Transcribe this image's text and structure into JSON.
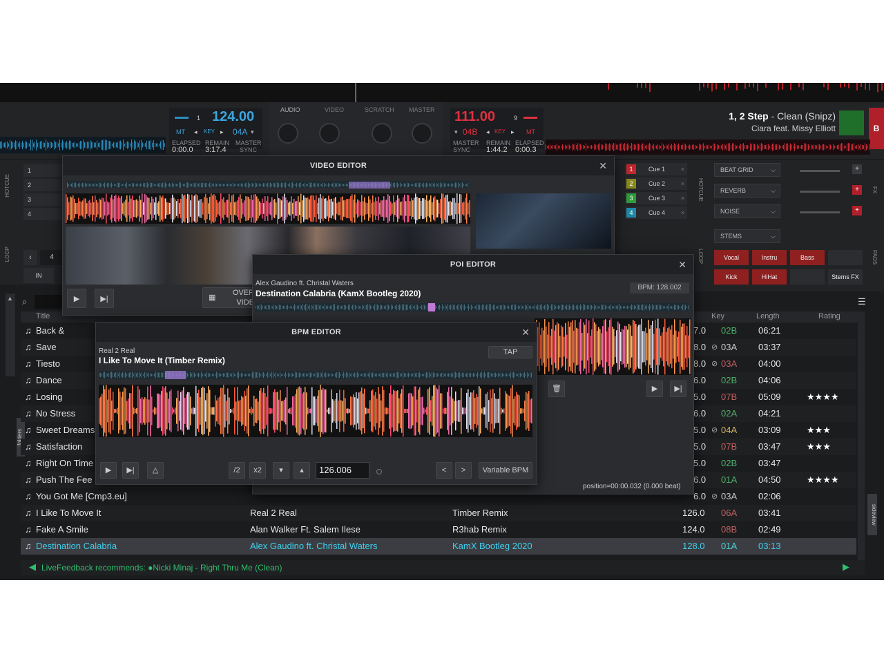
{
  "left_deck": {
    "bpm": "124.00",
    "key": "04A",
    "elapsed": "0:00.0",
    "remain": "3:17.4",
    "labels": {
      "elapsed": "ELAPSED",
      "remain": "REMAIN",
      "master": "MASTER",
      "sync": "SYNC",
      "mt": "MT",
      "key": "KEY"
    }
  },
  "mixer_tabs": [
    "AUDIO",
    "VIDEO",
    "SCRATCH",
    "MASTER"
  ],
  "right_deck": {
    "bpm": "111.00",
    "key": "04B",
    "remain": "1:44.2",
    "elapsed": "0:00.3",
    "title_bold": "1, 2 Step",
    "title_rest": " - Clean (Snipz)",
    "artist": "Ciara feat. Missy Elliott",
    "labels": {
      "master": "MASTER",
      "sync": "SYNC",
      "remain": "REMAIN",
      "elapsed": "ELAPSED",
      "mt": "MT",
      "key": "KEY"
    }
  },
  "left_hotcues": [
    "1",
    "2",
    "3",
    "4"
  ],
  "side_labels": {
    "hotcue": "HOTCUE",
    "loop": "LOOP",
    "fx": "FX",
    "pads": "PADS",
    "folders": "folders",
    "sideview": "sideview"
  },
  "loop": {
    "size": "4",
    "in": "IN"
  },
  "cues": [
    {
      "num": "1",
      "label": "Cue 1",
      "color": "#c0262d"
    },
    {
      "num": "2",
      "label": "Cue 2",
      "color": "#8a8a1e"
    },
    {
      "num": "3",
      "label": "Cue 3",
      "color": "#2f9b3b"
    },
    {
      "num": "4",
      "label": "Cue 4",
      "color": "#1f8aa8"
    }
  ],
  "fx": [
    "BEAT GRID",
    "REVERB",
    "NOISE"
  ],
  "stems": "STEMS",
  "pads": [
    {
      "label": "Vocal",
      "color": "#8f2020"
    },
    {
      "label": "Instru",
      "color": "#8f2020"
    },
    {
      "label": "Bass",
      "color": "#8f2020"
    },
    {
      "label": "Kick",
      "color": "#8f2020"
    },
    {
      "label": "HiHat",
      "color": "#8f2020"
    },
    {
      "label": "Stems FX",
      "color": "#2c2d30"
    }
  ],
  "video_editor": {
    "title": "VIDEO EDITOR",
    "overlay": "OVER",
    "video": "VIDE"
  },
  "poi_editor": {
    "title": "POI EDITOR",
    "artist": "Alex Gaudino ft. Christal Waters",
    "song": "Destination Calabria (KamX Bootleg 2020)",
    "bpm_label": "BPM: 128.002",
    "position": "position=00:00.032 (0.000 beat)"
  },
  "bpm_editor": {
    "title": "BPM EDITOR",
    "artist": "Real 2 Real",
    "song": "I Like To Move It (Timber Remix)",
    "tap": "TAP",
    "half": "/2",
    "double": "x2",
    "bpm_value": "126.006",
    "variable": "Variable BPM"
  },
  "browser": {
    "headers": {
      "title": "Title",
      "key": "Key",
      "length": "Length",
      "rating": "Rating"
    },
    "rows": [
      {
        "title": "Back &",
        "artist": "",
        "remix": "",
        "bpm": "7.0",
        "key": "02B",
        "keyColor": "#4fb06a",
        "lock": false,
        "length": "06:21",
        "stars": ""
      },
      {
        "title": "Save ",
        "artist": "",
        "remix": "",
        "bpm": "8.0",
        "key": "03A",
        "keyColor": "#c8c8c8",
        "lock": true,
        "length": "03:37",
        "stars": ""
      },
      {
        "title": "Tiesto",
        "artist": "",
        "remix": "",
        "bpm": "8.0",
        "key": "03A",
        "keyColor": "#c06060",
        "lock": true,
        "length": "04:00",
        "stars": ""
      },
      {
        "title": "Dance",
        "artist": "",
        "remix": "",
        "bpm": "6.0",
        "key": "02B",
        "keyColor": "#4fb06a",
        "lock": false,
        "length": "04:06",
        "stars": ""
      },
      {
        "title": "Losing",
        "artist": "",
        "remix": "",
        "bpm": "5.0",
        "key": "07B",
        "keyColor": "#c06060",
        "lock": false,
        "length": "05:09",
        "stars": "★★★★"
      },
      {
        "title": "No Stress",
        "artist": "",
        "remix": "",
        "bpm": "6.0",
        "key": "02A",
        "keyColor": "#4fb06a",
        "lock": false,
        "length": "04:21",
        "stars": ""
      },
      {
        "title": "Sweet Dreams",
        "artist": "",
        "remix": "",
        "bpm": "5.0",
        "key": "04A",
        "keyColor": "#d0b060",
        "lock": true,
        "length": "03:09",
        "stars": "★★★"
      },
      {
        "title": "Satisfaction",
        "artist": "",
        "remix": "",
        "bpm": "5.0",
        "key": "07B",
        "keyColor": "#c06060",
        "lock": false,
        "length": "03:47",
        "stars": "★★★"
      },
      {
        "title": "Right On Time",
        "artist": "",
        "remix": "",
        "bpm": "5.0",
        "key": "02B",
        "keyColor": "#4fb06a",
        "lock": false,
        "length": "03:47",
        "stars": ""
      },
      {
        "title": "Push The Fee",
        "artist": "",
        "remix": "",
        "bpm": "6.0",
        "key": "01A",
        "keyColor": "#4fb06a",
        "lock": false,
        "length": "04:50",
        "stars": "★★★★"
      },
      {
        "title": "You Got Me [Cmp3.eu]",
        "artist": "",
        "remix": "",
        "bpm": "6.0",
        "key": "03A",
        "keyColor": "#c8c8c8",
        "lock": true,
        "length": "02:06",
        "stars": ""
      },
      {
        "title": "I Like To Move It",
        "artist": "Real 2 Real",
        "remix": "Timber Remix",
        "bpm": "126.0",
        "key": "06A",
        "keyColor": "#c06060",
        "lock": false,
        "length": "03:41",
        "stars": ""
      },
      {
        "title": "Fake A Smile",
        "artist": "Alan Walker Ft. Salem Ilese",
        "remix": "R3hab Remix",
        "bpm": "124.0",
        "key": "08B",
        "keyColor": "#c06060",
        "lock": false,
        "length": "02:49",
        "stars": ""
      },
      {
        "title": "Destination Calabria",
        "artist": "Alex Gaudino ft. Christal Waters",
        "remix": "KamX Bootleg 2020",
        "bpm": "128.0",
        "key": "01A",
        "keyColor": "#4fd3d8",
        "lock": false,
        "length": "03:13",
        "stars": ""
      }
    ],
    "livefeedback": "LiveFeedback recommends: ●Nicki Minaj - Right Thru Me (Clean)"
  }
}
